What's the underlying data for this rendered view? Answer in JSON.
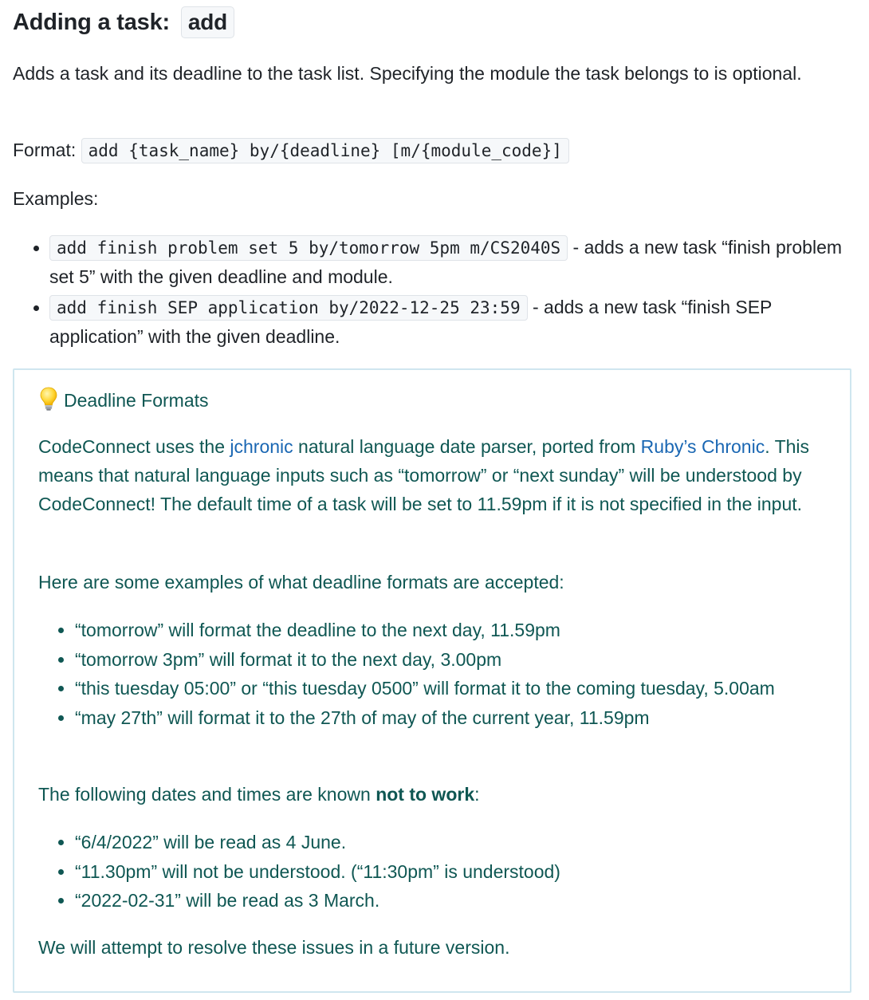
{
  "section": {
    "title_prefix": "Adding a task:",
    "title_code": "add"
  },
  "intro": "Adds a task and its deadline to the task list. Specifying the module the task belongs to is optional.",
  "format": {
    "label": "Format:",
    "code": "add {task_name} by/{deadline} [m/{module_code}]"
  },
  "examples": {
    "label": "Examples:",
    "items": [
      {
        "code": "add finish problem set 5 by/tomorrow 5pm m/CS2040S",
        "desc": " - adds a new task “finish problem set 5” with the given deadline and module."
      },
      {
        "code": "add finish SEP application by/2022-12-25 23:59",
        "desc": " - adds a new task “finish SEP application” with the given deadline."
      }
    ]
  },
  "tip": {
    "icon": "lightbulb-icon",
    "title": "Deadline Formats",
    "p1": {
      "t1": "CodeConnect uses the ",
      "link1": "jchronic",
      "t2": " natural language date parser, ported from ",
      "link2": "Ruby’s Chronic",
      "t3": ". This means that natural language inputs such as “tomorrow” or “next sunday” will be understood by CodeConnect! The default time of a task will be set to 11.59pm if it is not specified in the input."
    },
    "p2": "Here are some examples of what deadline formats are accepted:",
    "accepted": [
      "“tomorrow” will format the deadline to the next day, 11.59pm",
      "“tomorrow 3pm” will format it to the next day, 3.00pm",
      "“this tuesday 05:00” or “this tuesday 0500” will format it to the coming tuesday, 5.00am",
      "“may 27th” will format it to the 27th of may of the current year, 11.59pm"
    ],
    "p3": {
      "t1": "The following dates and times are known ",
      "bold": "not to work",
      "t2": ":"
    },
    "not_working": [
      "“6/4/2022” will be read as 4 June.",
      "“11.30pm” will not be understood. (“11:30pm” is understood)",
      "“2022-02-31” will be read as 3 March."
    ],
    "p4": "We will attempt to resolve these issues in a future version."
  },
  "colors": {
    "tip_text": "#0f5753",
    "tip_border": "#cfe6ef",
    "link": "#1a67b3",
    "code_bg": "#f6f8fa"
  }
}
